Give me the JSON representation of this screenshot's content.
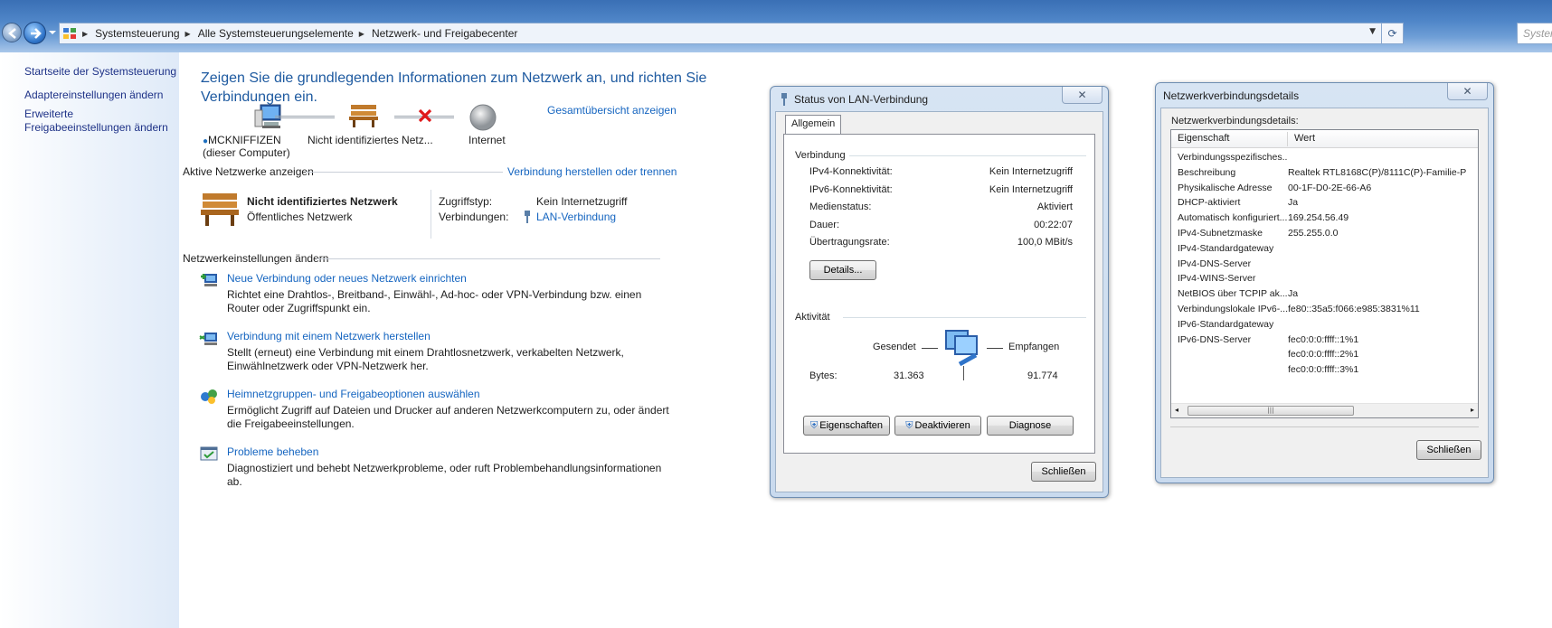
{
  "address_bar": {
    "breadcrumbs": [
      "Systemsteuerung",
      "Alle Systemsteuerungselemente",
      "Netzwerk- und Freigabecenter"
    ],
    "search_placeholder": "Systemsteuerung durchsuchen"
  },
  "sidebar": {
    "items": [
      {
        "label": "Startseite der Systemsteuerung"
      },
      {
        "label": "Adaptereinstellungen ändern"
      },
      {
        "label": "Erweiterte Freigabeeinstellungen ändern"
      }
    ]
  },
  "main": {
    "heading": "Zeigen Sie die grundlegenden Informationen zum Netzwerk an, und richten Sie Verbindungen ein.",
    "full_map_link": "Gesamtübersicht anzeigen",
    "map": {
      "computer_name": "MCKNIFFIZEN",
      "computer_sub": "(dieser Computer)",
      "network_label": "Nicht identifiziertes Netz...",
      "internet_label": "Internet"
    },
    "active_networks": {
      "title": "Aktive Netzwerke anzeigen",
      "connect_link": "Verbindung herstellen oder trennen",
      "network_name": "Nicht identifiziertes Netzwerk",
      "network_type": "Öffentliches Netzwerk",
      "access_type_label": "Zugriffstyp:",
      "access_type_value": "Kein Internetzugriff",
      "connections_label": "Verbindungen:",
      "connections_value": "LAN-Verbindung"
    },
    "change_settings": {
      "title": "Netzwerkeinstellungen ändern",
      "tasks": [
        {
          "title": "Neue Verbindung oder neues Netzwerk einrichten",
          "desc": "Richtet eine Drahtlos-, Breitband-, Einwähl-, Ad-hoc- oder VPN-Verbindung bzw. einen Router oder Zugriffspunkt ein."
        },
        {
          "title": "Verbindung mit einem Netzwerk herstellen",
          "desc": "Stellt (erneut) eine Verbindung mit einem Drahtlosnetzwerk, verkabelten Netzwerk, Einwählnetzwerk oder VPN-Netzwerk her."
        },
        {
          "title": "Heimnetzgruppen- und Freigabeoptionen auswählen",
          "desc": "Ermöglicht Zugriff auf Dateien und Drucker auf anderen Netzwerkcomputern zu, oder ändert die Freigabeeinstellungen."
        },
        {
          "title": "Probleme beheben",
          "desc": "Diagnostiziert und behebt Netzwerkprobleme, oder ruft Problembehandlungsinformationen ab."
        }
      ]
    }
  },
  "status_dialog": {
    "title": "Status von LAN-Verbindung",
    "tab": "Allgemein",
    "connection_group": "Verbindung",
    "rows": [
      {
        "label": "IPv4-Konnektivität:",
        "value": "Kein Internetzugriff"
      },
      {
        "label": "IPv6-Konnektivität:",
        "value": "Kein Internetzugriff"
      },
      {
        "label": "Medienstatus:",
        "value": "Aktiviert"
      },
      {
        "label": "Dauer:",
        "value": "00:22:07"
      },
      {
        "label": "Übertragungsrate:",
        "value": "100,0 MBit/s"
      }
    ],
    "details_button": "Details...",
    "activity_group": "Aktivität",
    "sent_label": "Gesendet",
    "received_label": "Empfangen",
    "bytes_label": "Bytes:",
    "bytes_sent": "31.363",
    "bytes_received": "91.774",
    "properties_button": "Eigenschaften",
    "disable_button": "Deaktivieren",
    "diagnose_button": "Diagnose",
    "close_button": "Schließen"
  },
  "details_dialog": {
    "title": "Netzwerkverbindungsdetails",
    "caption": "Netzwerkverbindungsdetails:",
    "col_property": "Eigenschaft",
    "col_value": "Wert",
    "rows": [
      {
        "k": "Verbindungsspezifisches...",
        "v": ""
      },
      {
        "k": "Beschreibung",
        "v": "Realtek RTL8168C(P)/8111C(P)-Familie-P"
      },
      {
        "k": "Physikalische Adresse",
        "v": "00-1F-D0-2E-66-A6"
      },
      {
        "k": "DHCP-aktiviert",
        "v": "Ja"
      },
      {
        "k": "Automatisch konfiguriert...",
        "v": "169.254.56.49"
      },
      {
        "k": "IPv4-Subnetzmaske",
        "v": "255.255.0.0"
      },
      {
        "k": "IPv4-Standardgateway",
        "v": ""
      },
      {
        "k": "IPv4-DNS-Server",
        "v": ""
      },
      {
        "k": "IPv4-WINS-Server",
        "v": ""
      },
      {
        "k": "NetBIOS über TCPIP ak...",
        "v": "Ja"
      },
      {
        "k": "Verbindungslokale IPv6-...",
        "v": "fe80::35a5:f066:e985:3831%11"
      },
      {
        "k": "IPv6-Standardgateway",
        "v": ""
      },
      {
        "k": "IPv6-DNS-Server",
        "v": "fec0:0:0:ffff::1%1"
      },
      {
        "k": "",
        "v": "fec0:0:0:ffff::2%1"
      },
      {
        "k": "",
        "v": "fec0:0:0:ffff::3%1"
      }
    ],
    "close_button": "Schließen"
  }
}
